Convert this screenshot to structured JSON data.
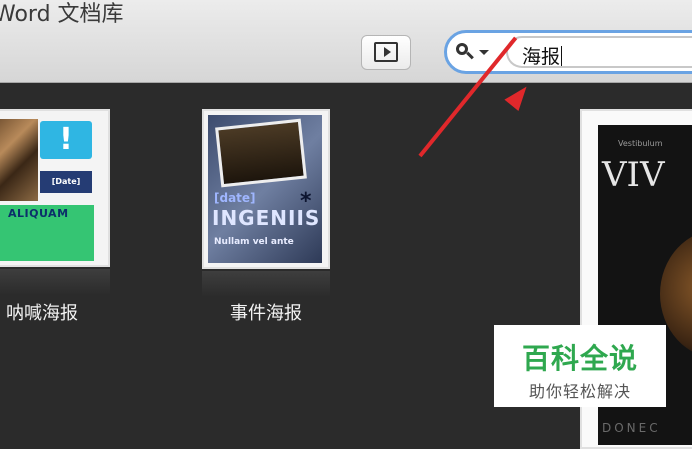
{
  "window": {
    "title": "Word 文档库"
  },
  "toolbar": {
    "play_icon": "slideshow-play-icon",
    "search": {
      "value": "海报",
      "icon": "search-menu-icon"
    }
  },
  "templates": [
    {
      "label": "呐喊海报",
      "thumb_text": {
        "badge": "!",
        "date": "[Date]",
        "heading": "ALIQUAM"
      }
    },
    {
      "label": "事件海报",
      "thumb_text": {
        "date": "[date]",
        "heading": "INGENIIS",
        "sub": "Nullam vel ante",
        "mark": "*"
      }
    },
    {
      "label": "",
      "thumb_text": {
        "small": "Vestibulum",
        "heading": "VIV",
        "footer": "DONEC"
      }
    }
  ],
  "annotation": {
    "arrow_color": "#e0282b"
  },
  "watermark": {
    "main": "百科全说",
    "sub": "助你轻松解决",
    "color": "#2fa84f"
  },
  "colors": {
    "search_focus": "#6aa3e3",
    "background": "#2b2b2b"
  }
}
